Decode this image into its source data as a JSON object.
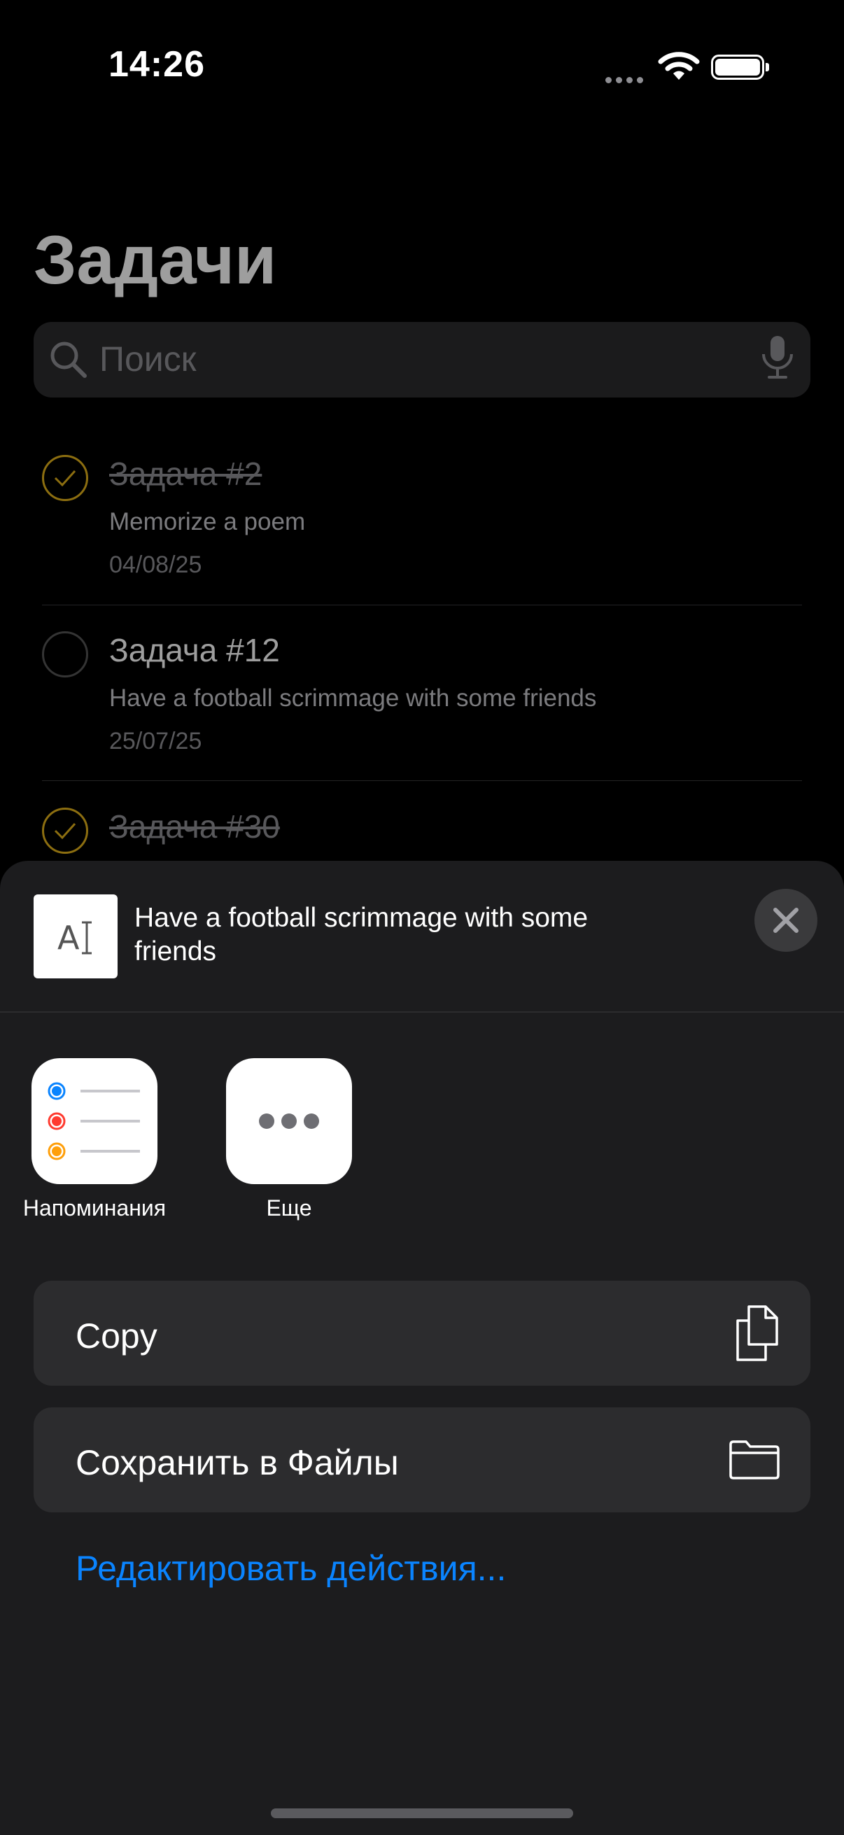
{
  "status_bar": {
    "time": "14:26"
  },
  "screen": {
    "title": "Задачи",
    "search": {
      "placeholder": "Поиск"
    },
    "tasks": [
      {
        "title": "Задача #2",
        "description": "Memorize a poem",
        "date": "04/08/25",
        "completed": true
      },
      {
        "title": "Задача #12",
        "description": "Have a football scrimmage with some friends",
        "date": "25/07/25",
        "completed": false
      },
      {
        "title": "Задача #30",
        "completed": true
      }
    ]
  },
  "share_sheet": {
    "preview_text": "Have a football scrimmage with some friends",
    "apps": [
      {
        "label": "Напоминания",
        "icon": "reminders-icon"
      },
      {
        "label": "Еще",
        "icon": "more-icon"
      }
    ],
    "actions": [
      {
        "label": "Copy",
        "icon": "copy-icon"
      },
      {
        "label": "Сохранить в Файлы",
        "icon": "folder-icon"
      }
    ],
    "edit_actions_label": "Редактировать действия..."
  },
  "colors": {
    "accent_check": "#e3b21a",
    "link": "#0a84ff",
    "reminder_dots": [
      "#0a84ff",
      "#ff3b30",
      "#ff9f0a"
    ]
  }
}
